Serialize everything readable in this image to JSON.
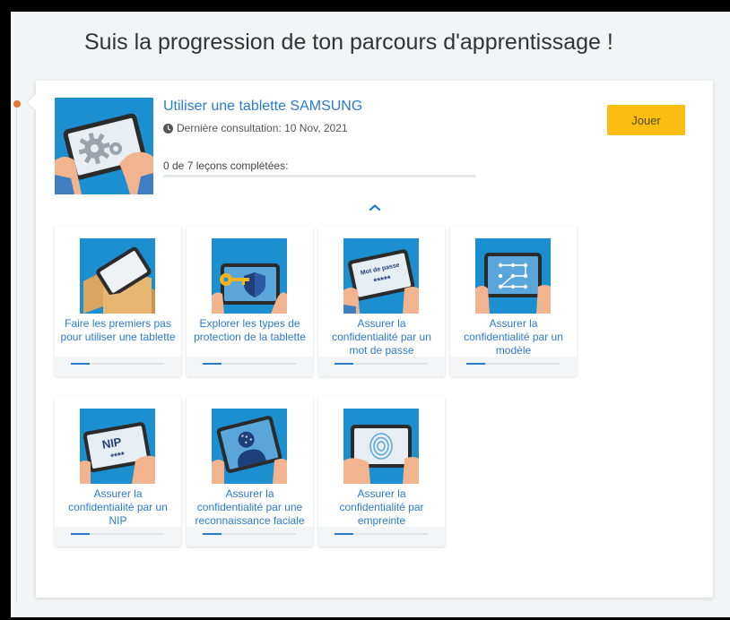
{
  "page": {
    "title": "Suis la progression de ton parcours d'apprentissage !"
  },
  "course": {
    "title": "Utiliser une tablette SAMSUNG",
    "last_viewed": "Dernière consultation: 10 Nov, 2021",
    "lessons_completed": "0 de 7 leçons complétées:",
    "progress": 0,
    "play_label": "Jouer",
    "thumbnail_icon": "tablet-settings-icon"
  },
  "colors": {
    "accent": "#2a7bd0",
    "play_button": "#fbbd12",
    "timeline_dot": "#e8742c",
    "thumbnail_bg": "#1b8fcf"
  },
  "lessons": [
    {
      "title": "Faire les premiers pas pour utiliser une tablette",
      "progress": 0.2,
      "icon": "tablet-in-box-icon"
    },
    {
      "title": "Explorer les types de protection de la tablette",
      "progress": 0.2,
      "icon": "key-shield-icon"
    },
    {
      "title": "Assurer la confidentialité par un mot de passe",
      "progress": 0.2,
      "icon": "password-tablet-icon",
      "thumb_text": "Mot de passe",
      "thumb_dots": "*****"
    },
    {
      "title": "Assurer la confidentialité par un modèle",
      "progress": 0.2,
      "icon": "pattern-lock-icon"
    },
    {
      "title": "Assurer la confidentialité par un NIP",
      "progress": 0.2,
      "icon": "pin-tablet-icon",
      "thumb_text": "NIP",
      "thumb_dots": "****"
    },
    {
      "title": "Assurer la confidentialité par une reconnaissance faciale",
      "progress": 0.2,
      "icon": "face-recognition-icon"
    },
    {
      "title": "Assurer la confidentialité par empreinte",
      "progress": 0.2,
      "icon": "fingerprint-icon"
    }
  ]
}
